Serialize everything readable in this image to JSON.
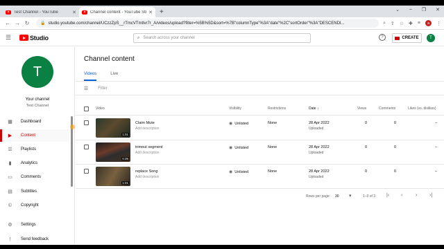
{
  "browser": {
    "tabs": [
      {
        "title": "Test Channel - YouTube",
        "active": false
      },
      {
        "title": "Channel content - YouTube Studio",
        "active": true
      }
    ],
    "url": "studio.youtube.com/channel/UCzzZpS__rTmcVTmtlvr7r_A/videos/upload?filter=%5B%5D&sort=%7B\"columnType\"%3A\"date\"%2C\"sortOrder\"%3A\"DESCENDI...",
    "profile_initial": "a"
  },
  "header": {
    "logo_text": "Studio",
    "search_placeholder": "Search across your channel",
    "help_label": "?",
    "create_label": "CREATE",
    "avatar_initial": "T"
  },
  "sidebar": {
    "avatar_initial": "T",
    "your_channel_label": "Your channel",
    "channel_name": "Test Channel",
    "items": [
      {
        "label": "Dashboard",
        "icon": "dashboard-icon",
        "active": false
      },
      {
        "label": "Content",
        "icon": "content-icon",
        "active": true
      },
      {
        "label": "Playlists",
        "icon": "playlists-icon",
        "active": false
      },
      {
        "label": "Analytics",
        "icon": "analytics-icon",
        "active": false
      },
      {
        "label": "Comments",
        "icon": "comments-icon",
        "active": false
      },
      {
        "label": "Subtitles",
        "icon": "subtitles-icon",
        "active": false
      },
      {
        "label": "Copyright",
        "icon": "copyright-icon",
        "active": false
      },
      {
        "label": "Settings",
        "icon": "gear-icon",
        "active": false
      },
      {
        "label": "Send feedback",
        "icon": "feedback-icon",
        "active": false
      }
    ]
  },
  "main": {
    "title": "Channel content",
    "tabs": [
      {
        "label": "Videos",
        "active": true
      },
      {
        "label": "Live",
        "active": false
      }
    ],
    "filter_placeholder": "Filter",
    "columns": {
      "video": "Video",
      "visibility": "Visibility",
      "restrictions": "Restrictions",
      "date": "Date",
      "views": "Views",
      "comments": "Comments",
      "likes": "Likes (vs. dislikes)"
    },
    "rows": [
      {
        "title": "Claim Mute",
        "description": "Add description",
        "duration": "1:01",
        "visibility": "Unlisted",
        "restrictions": "None",
        "date": "28 Apr 2022",
        "status": "Uploaded",
        "views": "0",
        "comments": "0",
        "likes": "–"
      },
      {
        "title": "trimout segment",
        "description": "Add description",
        "duration": "0:36",
        "visibility": "Unlisted",
        "restrictions": "None",
        "date": "28 Apr 2022",
        "status": "Uploaded",
        "views": "0",
        "comments": "0",
        "likes": "–"
      },
      {
        "title": "replace Song",
        "description": "Add description",
        "duration": "1:01",
        "visibility": "Unlisted",
        "restrictions": "None",
        "date": "28 Apr 2022",
        "status": "Uploaded",
        "views": "0",
        "comments": "0",
        "likes": "–"
      }
    ],
    "pagination": {
      "rows_per_page_label": "Rows per page:",
      "rows_per_page": "30",
      "range": "1–3 of 3"
    }
  },
  "colors": {
    "accent_red": "#cc0000",
    "link_blue": "#065fd4",
    "avatar_green": "#0b8043"
  }
}
